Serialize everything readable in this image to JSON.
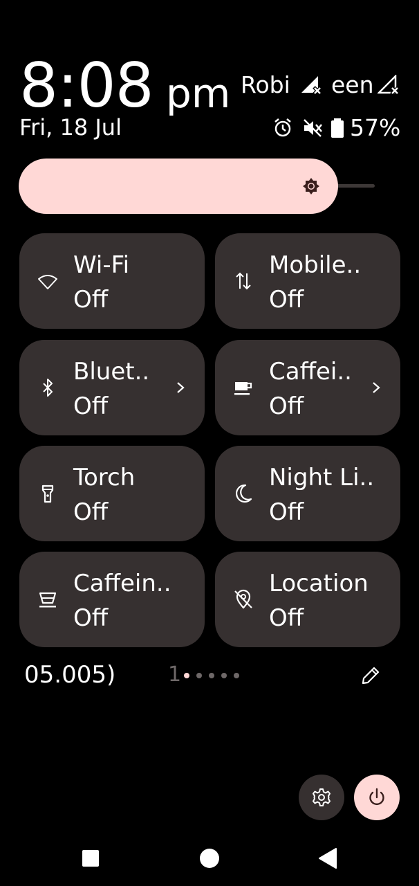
{
  "header": {
    "time": "8:08",
    "ampm": "pm",
    "date": "Fri, 18 Jul",
    "carrier1": "Robi",
    "carrier2": "een",
    "battery_percent": "57%",
    "status_icons": [
      "alarm-icon",
      "vibrate-off-icon",
      "battery-icon"
    ]
  },
  "brightness": {
    "level": 0.85,
    "icon": "brightness-icon"
  },
  "tiles": [
    {
      "label": "Wi-Fi",
      "state": "Off",
      "icon": "wifi-icon"
    },
    {
      "label": "Mobile..",
      "state": "Off",
      "icon": "mobile-data-icon"
    },
    {
      "label": "Bluet..",
      "state": "Off",
      "icon": "bluetooth-icon",
      "chevron": true
    },
    {
      "label": "Caffei..",
      "state": "Off",
      "icon": "coffee-cup-icon",
      "chevron": true
    },
    {
      "label": "Torch",
      "state": "Off",
      "icon": "torch-icon"
    },
    {
      "label": "Night Li..",
      "state": "Off",
      "icon": "moon-icon"
    },
    {
      "label": "Caffein..",
      "state": "Off",
      "icon": "cup-icon"
    },
    {
      "label": "Location",
      "state": "Off",
      "icon": "location-off-icon"
    }
  ],
  "footer": {
    "build_text": "05.005)",
    "page_number": "1",
    "page_count": 5,
    "active_page": 0
  },
  "colors": {
    "accent": "#ffd8d6",
    "tile_bg": "#363030",
    "background": "#000000"
  }
}
